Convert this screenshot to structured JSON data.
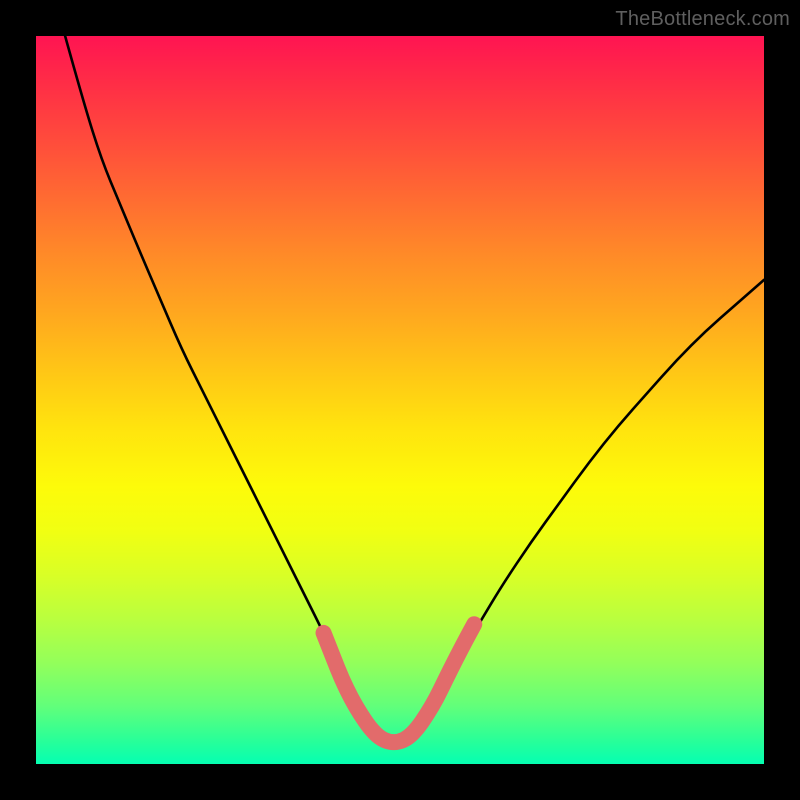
{
  "watermark_text": "TheBottleneck.com",
  "chart_data": {
    "type": "line",
    "title": "",
    "xlabel": "",
    "ylabel": "",
    "xlim": [
      0,
      1
    ],
    "ylim": [
      0,
      1
    ],
    "grid": false,
    "series": [
      {
        "name": "bottleneck-curve",
        "color": "#000000",
        "x": [
          0.04,
          0.065,
          0.09,
          0.115,
          0.14,
          0.17,
          0.2,
          0.23,
          0.26,
          0.29,
          0.32,
          0.345,
          0.37,
          0.395,
          0.418,
          0.44,
          0.462,
          0.484,
          0.506,
          0.528,
          0.55,
          0.58,
          0.61,
          0.64,
          0.68,
          0.72,
          0.76,
          0.8,
          0.84,
          0.88,
          0.92,
          0.96,
          1.0
        ],
        "y": [
          1.0,
          0.91,
          0.83,
          0.77,
          0.71,
          0.64,
          0.57,
          0.51,
          0.45,
          0.39,
          0.33,
          0.28,
          0.23,
          0.18,
          0.13,
          0.09,
          0.055,
          0.03,
          0.03,
          0.055,
          0.09,
          0.145,
          0.195,
          0.245,
          0.305,
          0.36,
          0.415,
          0.465,
          0.51,
          0.555,
          0.595,
          0.63,
          0.665
        ]
      },
      {
        "name": "highlight-valley",
        "color": "#e26b6b",
        "x": [
          0.395,
          0.408,
          0.42,
          0.433,
          0.446,
          0.459,
          0.472,
          0.485,
          0.498,
          0.511,
          0.524,
          0.537,
          0.55,
          0.563,
          0.576,
          0.589,
          0.602
        ],
        "y": [
          0.18,
          0.147,
          0.117,
          0.09,
          0.068,
          0.049,
          0.036,
          0.03,
          0.03,
          0.036,
          0.049,
          0.068,
          0.09,
          0.117,
          0.143,
          0.168,
          0.192
        ]
      }
    ]
  },
  "colors": {
    "black": "#000000",
    "highlight": "#e26b6b",
    "watermark": "#5f5f5f"
  }
}
